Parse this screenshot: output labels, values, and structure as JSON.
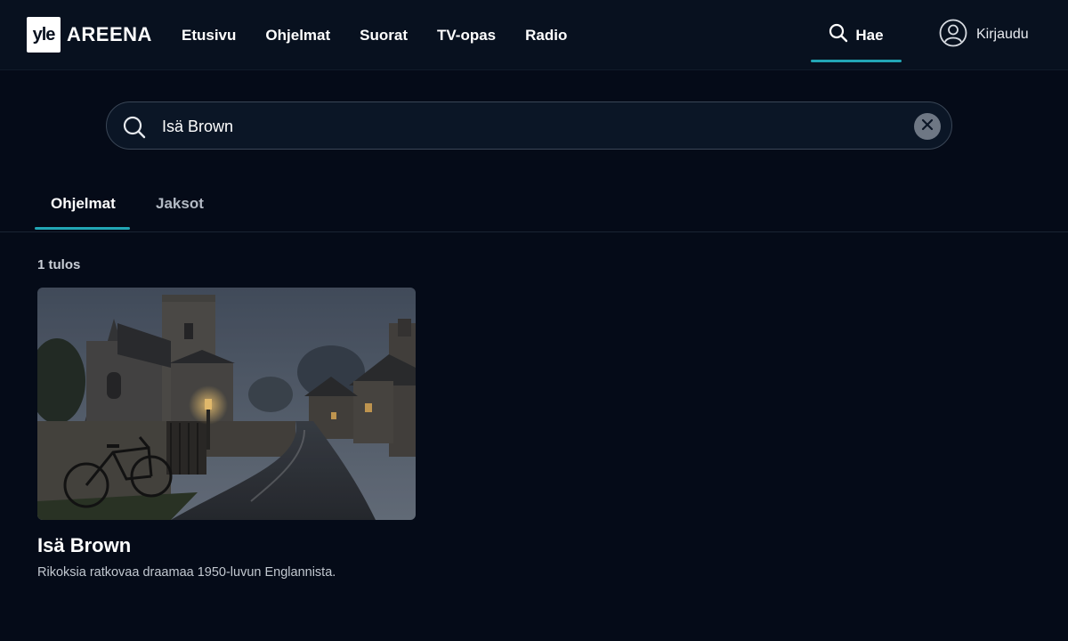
{
  "header": {
    "logo_mark": "yle",
    "logo_text": "AREENA",
    "nav": [
      {
        "label": "Etusivu"
      },
      {
        "label": "Ohjelmat"
      },
      {
        "label": "Suorat"
      },
      {
        "label": "TV-opas"
      },
      {
        "label": "Radio"
      }
    ],
    "search_label": "Hae",
    "login_label": "Kirjaudu",
    "icons": {
      "search": "search-icon",
      "user": "user-circle-icon"
    }
  },
  "search": {
    "value": "Isä Brown",
    "clear_icon": "clear-x-icon"
  },
  "tabs": [
    {
      "label": "Ohjelmat",
      "active": true
    },
    {
      "label": "Jaksot",
      "active": false
    }
  ],
  "results": {
    "count_text": "1 tulos",
    "items": [
      {
        "title": "Isä Brown",
        "description": "Rikoksia ratkovaa draamaa 1950-luvun Englannista."
      }
    ]
  },
  "colors": {
    "background": "#050b18",
    "accent": "#22a6b5"
  }
}
